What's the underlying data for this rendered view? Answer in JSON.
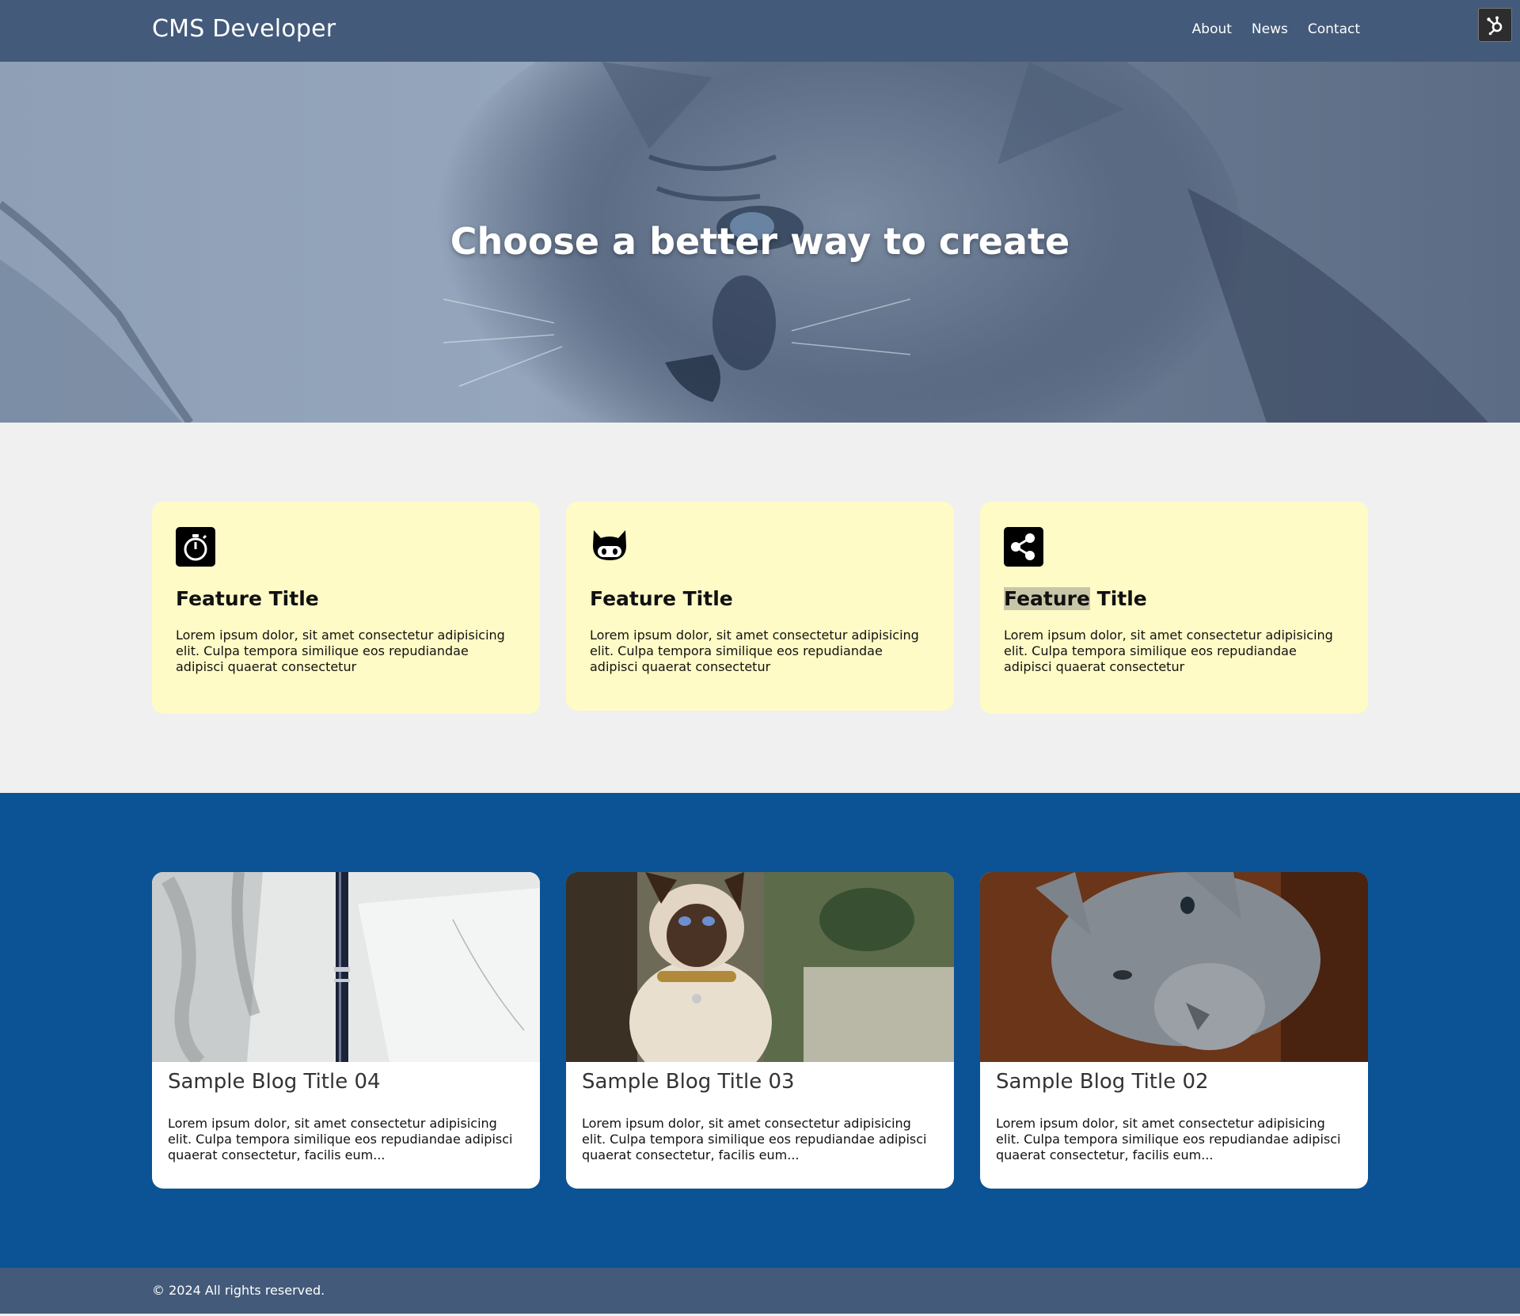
{
  "header": {
    "brand": "CMS Developer",
    "nav": [
      {
        "label": "About"
      },
      {
        "label": "News"
      },
      {
        "label": "Contact"
      }
    ]
  },
  "hero": {
    "title": "Choose a better way to create"
  },
  "features": [
    {
      "icon": "stopwatch-icon",
      "title": "Feature Title",
      "text": "Lorem ipsum dolor, sit amet consectetur adipisicing elit. Culpa tempora similique eos repudiandae adipisci quaerat consectetur"
    },
    {
      "icon": "github-icon",
      "title": "Feature Title",
      "text": "Lorem ipsum dolor, sit amet consectetur adipisicing elit. Culpa tempora similique eos repudiandae adipisci quaerat consectetur"
    },
    {
      "icon": "share-icon",
      "title_highlight": "Feature",
      "title_rest": " Title",
      "text": "Lorem ipsum dolor, sit amet consectetur adipisicing elit. Culpa tempora similique eos repudiandae adipisci quaerat consectetur"
    }
  ],
  "blog": [
    {
      "title": "Sample Blog Title 04",
      "excerpt": "Lorem ipsum dolor, sit amet consectetur adipisicing elit. Culpa tempora similique eos repudiandae adipisci quaerat consectetur, facilis eum..."
    },
    {
      "title": "Sample Blog Title 03",
      "excerpt": "Lorem ipsum dolor, sit amet consectetur adipisicing elit. Culpa tempora similique eos repudiandae adipisci quaerat consectetur, facilis eum..."
    },
    {
      "title": "Sample Blog Title 02",
      "excerpt": "Lorem ipsum dolor, sit amet consectetur adipisicing elit. Culpa tempora similique eos repudiandae adipisci quaerat consectetur, facilis eum..."
    }
  ],
  "footer": {
    "copyright": "© 2024 All rights reserved."
  },
  "colors": {
    "header_bg": "#435a7a",
    "feature_card_bg": "#fffbc6",
    "blog_section_bg": "#0b5394",
    "page_bg": "#f0f0f0"
  }
}
